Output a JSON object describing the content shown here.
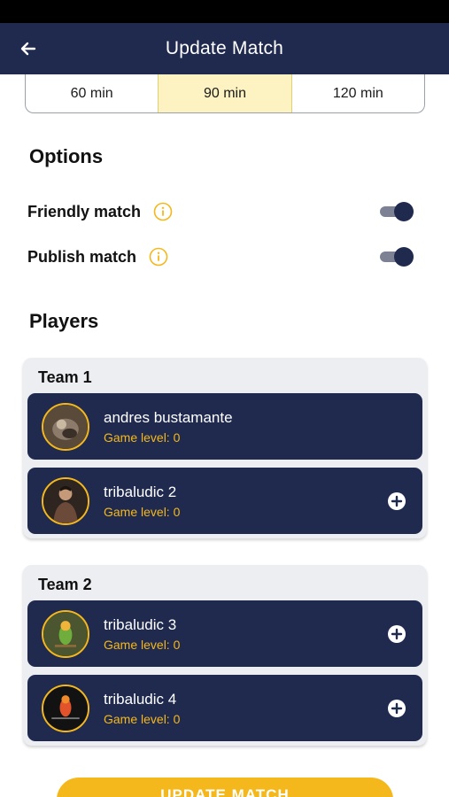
{
  "header": {
    "title": "Update Match",
    "back_icon": "arrow-left-icon"
  },
  "duration": {
    "options": [
      "60 min",
      "90 min",
      "120 min"
    ],
    "selected": "90 min"
  },
  "options": {
    "title": "Options",
    "items": [
      {
        "label": "Friendly match",
        "enabled": true
      },
      {
        "label": "Publish match",
        "enabled": true
      }
    ]
  },
  "players": {
    "title": "Players",
    "teams": [
      {
        "name": "Team 1",
        "players": [
          {
            "name": "andres bustamante",
            "level": "Game level: 0",
            "has_add": false
          },
          {
            "name": "tribaludic 2",
            "level": "Game level: 0",
            "has_add": true
          }
        ]
      },
      {
        "name": "Team 2",
        "players": [
          {
            "name": "tribaludic 3",
            "level": "Game level: 0",
            "has_add": true
          },
          {
            "name": "tribaludic 4",
            "level": "Game level: 0",
            "has_add": true
          }
        ]
      }
    ]
  },
  "update_button": {
    "label": "UPDATE MATCH"
  },
  "colors": {
    "navy": "#1f2a4e",
    "accent": "#f5b81c",
    "selected_bg": "#fdf2c2",
    "card_bg": "#eceef1"
  }
}
